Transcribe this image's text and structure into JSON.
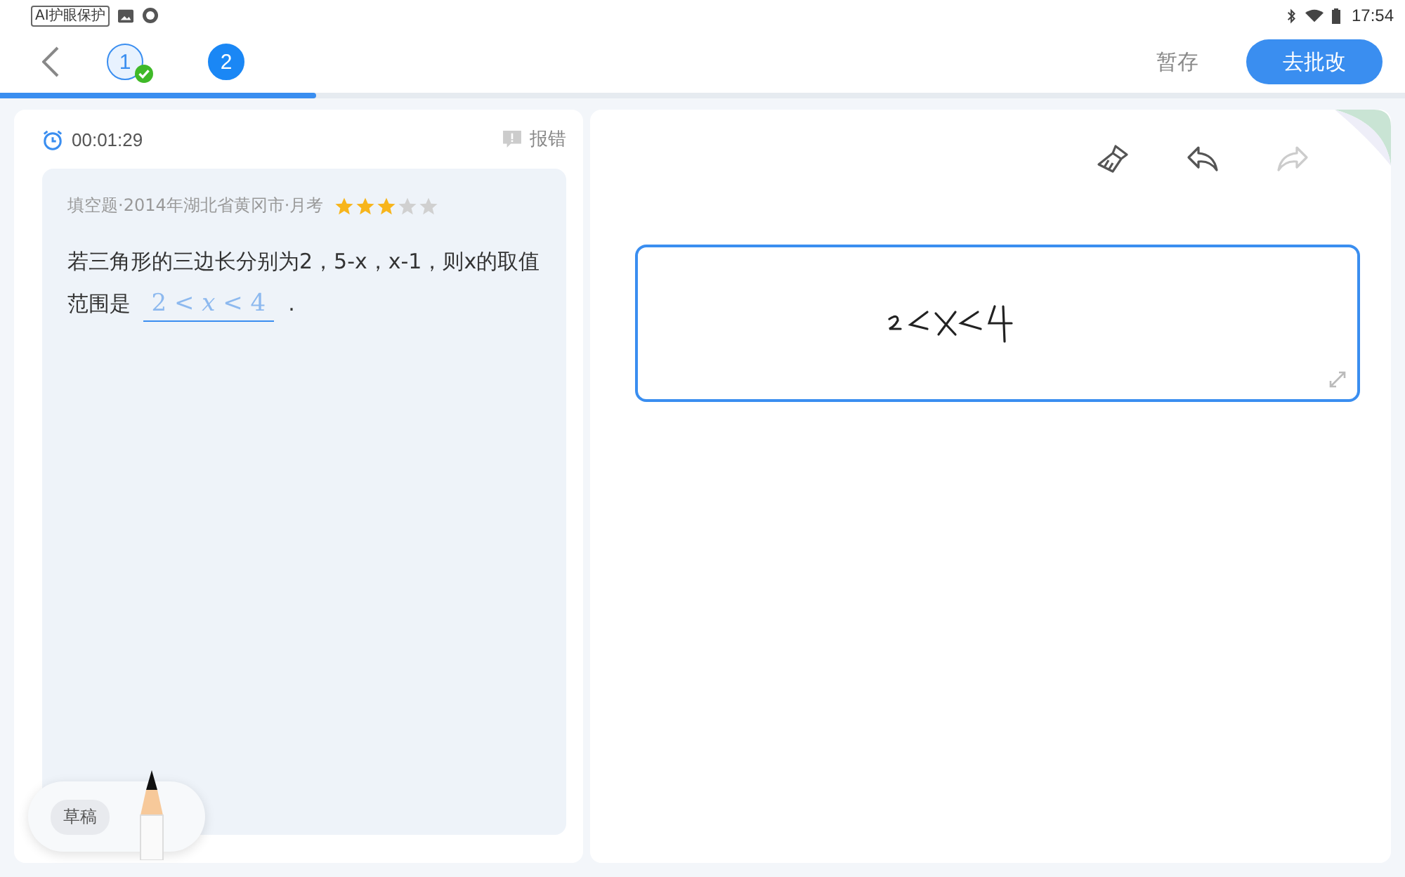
{
  "status_bar": {
    "badge": "AI护眼保护",
    "time": "17:54"
  },
  "header": {
    "steps": [
      {
        "label": "1",
        "done": true,
        "selected": false
      },
      {
        "label": "2",
        "done": false,
        "selected": true
      }
    ],
    "save": "暂存",
    "submit": "去批改",
    "progress": {
      "level": 0.225
    }
  },
  "question": {
    "timer": "00:01:29",
    "report": "报错",
    "meta": "填空题·2014年湖北省黄冈市·月考",
    "stars": 3,
    "text": "若三角形的三边长分别为2，5-x，x-1，则x的取值范围是",
    "answer": "2 < *x* < 4",
    "end": "."
  },
  "draft": "草稿",
  "tools": [
    {
      "kind": "clear",
      "disabled": false
    },
    {
      "kind": "undo",
      "disabled": false
    },
    {
      "kind": "redo",
      "disabled": true
    }
  ]
}
